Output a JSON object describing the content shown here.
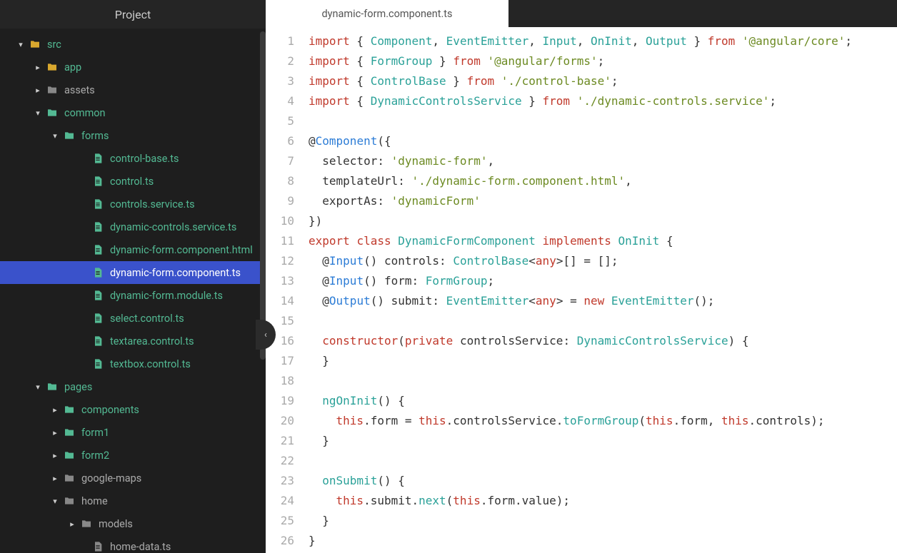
{
  "sidebar": {
    "title": "Project",
    "tree": [
      {
        "indent": 1,
        "chev": "down",
        "icon": "folder",
        "color": "yellow",
        "label": "src",
        "grey": false
      },
      {
        "indent": 2,
        "chev": "right",
        "icon": "folder",
        "color": "yellow",
        "label": "app",
        "grey": false
      },
      {
        "indent": 2,
        "chev": "right",
        "icon": "folder",
        "color": "grey",
        "label": "assets",
        "grey": true
      },
      {
        "indent": 2,
        "chev": "down",
        "icon": "folder",
        "color": "green",
        "label": "common",
        "grey": false
      },
      {
        "indent": 3,
        "chev": "down",
        "icon": "folder",
        "color": "green",
        "label": "forms",
        "grey": false
      },
      {
        "indent": 5,
        "chev": "",
        "icon": "file",
        "color": "green",
        "label": "control-base.ts",
        "grey": false
      },
      {
        "indent": 5,
        "chev": "",
        "icon": "file",
        "color": "green",
        "label": "control.ts",
        "grey": false
      },
      {
        "indent": 5,
        "chev": "",
        "icon": "file",
        "color": "green",
        "label": "controls.service.ts",
        "grey": false
      },
      {
        "indent": 5,
        "chev": "",
        "icon": "file",
        "color": "green",
        "label": "dynamic-controls.service.ts",
        "grey": false
      },
      {
        "indent": 5,
        "chev": "",
        "icon": "file",
        "color": "green",
        "label": "dynamic-form.component.html",
        "grey": false
      },
      {
        "indent": 5,
        "chev": "",
        "icon": "file",
        "color": "green",
        "label": "dynamic-form.component.ts",
        "grey": false,
        "selected": true
      },
      {
        "indent": 5,
        "chev": "",
        "icon": "file",
        "color": "green",
        "label": "dynamic-form.module.ts",
        "grey": false
      },
      {
        "indent": 5,
        "chev": "",
        "icon": "file",
        "color": "green",
        "label": "select.control.ts",
        "grey": false
      },
      {
        "indent": 5,
        "chev": "",
        "icon": "file",
        "color": "green",
        "label": "textarea.control.ts",
        "grey": false
      },
      {
        "indent": 5,
        "chev": "",
        "icon": "file",
        "color": "green",
        "label": "textbox.control.ts",
        "grey": false
      },
      {
        "indent": 2,
        "chev": "down",
        "icon": "folder",
        "color": "green",
        "label": "pages",
        "grey": false
      },
      {
        "indent": 3,
        "chev": "right",
        "icon": "folder",
        "color": "green",
        "label": "components",
        "grey": false
      },
      {
        "indent": 3,
        "chev": "right",
        "icon": "folder",
        "color": "green",
        "label": "form1",
        "grey": false
      },
      {
        "indent": 3,
        "chev": "right",
        "icon": "folder",
        "color": "green",
        "label": "form2",
        "grey": false
      },
      {
        "indent": 3,
        "chev": "right",
        "icon": "folder",
        "color": "grey",
        "label": "google-maps",
        "grey": true
      },
      {
        "indent": 3,
        "chev": "down",
        "icon": "folder",
        "color": "grey",
        "label": "home",
        "grey": true
      },
      {
        "indent": 4,
        "chev": "right",
        "icon": "folder",
        "color": "grey",
        "label": "models",
        "grey": true
      },
      {
        "indent": 5,
        "chev": "",
        "icon": "file",
        "color": "grey",
        "label": "home-data.ts",
        "grey": true
      }
    ]
  },
  "tab": {
    "label": "dynamic-form.component.ts"
  },
  "code": {
    "lines": [
      [
        {
          "t": "import",
          "c": "kw"
        },
        {
          "t": " { "
        },
        {
          "t": "Component",
          "c": "type"
        },
        {
          "t": ", "
        },
        {
          "t": "EventEmitter",
          "c": "type"
        },
        {
          "t": ", "
        },
        {
          "t": "Input",
          "c": "type"
        },
        {
          "t": ", "
        },
        {
          "t": "OnInit",
          "c": "type"
        },
        {
          "t": ", "
        },
        {
          "t": "Output",
          "c": "type"
        },
        {
          "t": " } "
        },
        {
          "t": "from",
          "c": "kw"
        },
        {
          "t": " "
        },
        {
          "t": "'@angular/core'",
          "c": "str"
        },
        {
          "t": ";"
        }
      ],
      [
        {
          "t": "import",
          "c": "kw"
        },
        {
          "t": " { "
        },
        {
          "t": "FormGroup",
          "c": "type"
        },
        {
          "t": " } "
        },
        {
          "t": "from",
          "c": "kw"
        },
        {
          "t": " "
        },
        {
          "t": "'@angular/forms'",
          "c": "str"
        },
        {
          "t": ";"
        }
      ],
      [
        {
          "t": "import",
          "c": "kw"
        },
        {
          "t": " { "
        },
        {
          "t": "ControlBase",
          "c": "type"
        },
        {
          "t": " } "
        },
        {
          "t": "from",
          "c": "kw"
        },
        {
          "t": " "
        },
        {
          "t": "'./control-base'",
          "c": "str"
        },
        {
          "t": ";"
        }
      ],
      [
        {
          "t": "import",
          "c": "kw"
        },
        {
          "t": " { "
        },
        {
          "t": "DynamicControlsService",
          "c": "type"
        },
        {
          "t": " } "
        },
        {
          "t": "from",
          "c": "kw"
        },
        {
          "t": " "
        },
        {
          "t": "'./dynamic-controls.service'",
          "c": "str"
        },
        {
          "t": ";"
        }
      ],
      [],
      [
        {
          "t": "@"
        },
        {
          "t": "Component",
          "c": "dec"
        },
        {
          "t": "({"
        }
      ],
      [
        {
          "t": "  selector: ",
          "hl": true
        },
        {
          "t": "'dynamic-form'",
          "c": "str"
        },
        {
          "t": ","
        }
      ],
      [
        {
          "t": "  templateUrl: "
        },
        {
          "t": "'./dynamic-form.component.html'",
          "c": "str"
        },
        {
          "t": ","
        }
      ],
      [
        {
          "t": "  exportAs: "
        },
        {
          "t": "'dynamicForm'",
          "c": "str"
        }
      ],
      [
        {
          "t": "})"
        }
      ],
      [
        {
          "t": "export",
          "c": "kw"
        },
        {
          "t": " "
        },
        {
          "t": "class",
          "c": "kw"
        },
        {
          "t": " "
        },
        {
          "t": "DynamicFormComponent",
          "c": "type"
        },
        {
          "t": " "
        },
        {
          "t": "implements",
          "c": "kw"
        },
        {
          "t": " "
        },
        {
          "t": "OnInit",
          "c": "type"
        },
        {
          "t": " {"
        }
      ],
      [
        {
          "t": "  @"
        },
        {
          "t": "Input",
          "c": "dec"
        },
        {
          "t": "() controls: "
        },
        {
          "t": "ControlBase",
          "c": "type"
        },
        {
          "t": "<"
        },
        {
          "t": "any",
          "c": "kw"
        },
        {
          "t": ">[] = [];"
        }
      ],
      [
        {
          "t": "  @"
        },
        {
          "t": "Input",
          "c": "dec"
        },
        {
          "t": "() form: "
        },
        {
          "t": "FormGroup",
          "c": "type"
        },
        {
          "t": ";"
        }
      ],
      [
        {
          "t": "  @"
        },
        {
          "t": "Output",
          "c": "dec"
        },
        {
          "t": "() submit: "
        },
        {
          "t": "EventEmitter",
          "c": "type"
        },
        {
          "t": "<"
        },
        {
          "t": "any",
          "c": "kw"
        },
        {
          "t": "> = "
        },
        {
          "t": "new",
          "c": "kw"
        },
        {
          "t": " "
        },
        {
          "t": "EventEmitter",
          "c": "type"
        },
        {
          "t": "();"
        }
      ],
      [],
      [
        {
          "t": "  "
        },
        {
          "t": "constructor",
          "c": "kw"
        },
        {
          "t": "("
        },
        {
          "t": "private",
          "c": "kw"
        },
        {
          "t": " controlsService: "
        },
        {
          "t": "DynamicControlsService",
          "c": "type"
        },
        {
          "t": ") {"
        }
      ],
      [
        {
          "t": "  }"
        }
      ],
      [],
      [
        {
          "t": "  "
        },
        {
          "t": "ngOnInit",
          "c": "method"
        },
        {
          "t": "() {"
        }
      ],
      [
        {
          "t": "    "
        },
        {
          "t": "this",
          "c": "kw"
        },
        {
          "t": ".form = "
        },
        {
          "t": "this",
          "c": "kw"
        },
        {
          "t": ".controlsService."
        },
        {
          "t": "toFormGroup",
          "c": "method"
        },
        {
          "t": "("
        },
        {
          "t": "this",
          "c": "kw"
        },
        {
          "t": ".form, "
        },
        {
          "t": "this",
          "c": "kw"
        },
        {
          "t": ".controls);"
        }
      ],
      [
        {
          "t": "  }"
        }
      ],
      [],
      [
        {
          "t": "  "
        },
        {
          "t": "onSubmit",
          "c": "method"
        },
        {
          "t": "() {"
        }
      ],
      [
        {
          "t": "    "
        },
        {
          "t": "this",
          "c": "kw"
        },
        {
          "t": ".submit."
        },
        {
          "t": "next",
          "c": "method"
        },
        {
          "t": "("
        },
        {
          "t": "this",
          "c": "kw"
        },
        {
          "t": ".form.value);"
        }
      ],
      [
        {
          "t": "  }"
        }
      ],
      [
        {
          "t": "}"
        }
      ]
    ]
  }
}
